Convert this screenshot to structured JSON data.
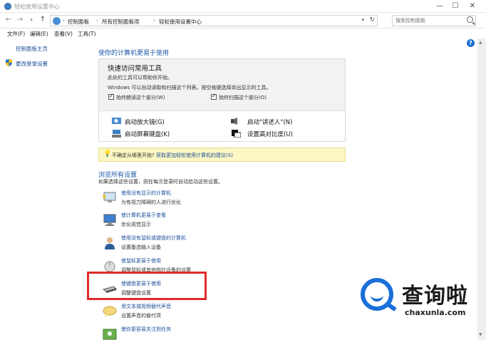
{
  "window": {
    "title": "轻松使用设置中心",
    "controls": [
      "—",
      "☐",
      "✕"
    ]
  },
  "address": {
    "crumbs": [
      "控制面板",
      "所有控制面板项",
      "轻松使用设置中心"
    ],
    "search_placeholder": "搜索控制面板"
  },
  "menu": [
    "文件(F)",
    "编辑(E)",
    "查看(V)",
    "工具(T)"
  ],
  "left": {
    "home": "控制面板主页",
    "login": "更改登录设置"
  },
  "main": {
    "heading": "使你的计算机更易于使用",
    "quick": {
      "title": "快速访问常用工具",
      "line1": "此处的工具可以帮助你开始。",
      "line2": "Windows 可以自动读取和扫描这个列表。按空格键选择突出显示的工具。",
      "cb1": "始终朗读这个部分(W)",
      "cb2": "始终扫描这个部分(O)",
      "tools": [
        "启动放大镜(G)",
        "启动\"讲述人\"(N)",
        "启动屏幕键盘(K)",
        "设置高对比度(U)"
      ]
    },
    "hint": {
      "prefix": "不确定从哪里开始?",
      "link": "获取更加轻松使用计算机的建议(S)"
    },
    "browse": {
      "heading": "浏览所有设置",
      "desc": "如果选择这些设置，则在每次登录时自动启动这些设置。",
      "items": [
        {
          "title": "使用没有显示的计算机",
          "sub": "为有视力障碍的人进行优化"
        },
        {
          "title": "使计算机更易于查看",
          "sub": "优化视觉显示"
        },
        {
          "title": "使用没有鼠标或键盘的计算机",
          "sub": "设置备选输入设备"
        },
        {
          "title": "使鼠标更易于使用",
          "sub": "调整鼠标或其他指针设备的设置"
        },
        {
          "title": "使键盘更易于使用",
          "sub": "调整键盘设置"
        },
        {
          "title": "用文本或视频替代声音",
          "sub": "设置声音的替代项"
        },
        {
          "title": "使你更容易关注到任务",
          "sub": ""
        }
      ]
    }
  },
  "watermark": {
    "cn": "查询啦",
    "url": "chaxunla.com"
  },
  "colors": {
    "link": "#1a4d9a",
    "heading": "#1e5aa8",
    "highlight_border": "#e02b2b",
    "hint_bg": "#fcf7c3",
    "brand_blue": "#1a6fd8"
  }
}
